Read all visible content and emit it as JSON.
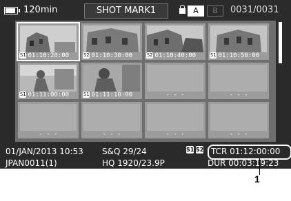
{
  "top_bar": {
    "battery_time": "120min",
    "screen_title": "SHOT MARK1",
    "slot_a": "A",
    "slot_b": "B",
    "clip_counter": "0031/0031"
  },
  "thumbnails": [
    {
      "mark": "S1",
      "timecode": "01:10:20:00",
      "image": "building-photo"
    },
    {
      "mark": "S2",
      "timecode": "01:10:30:00",
      "image": "building-photo"
    },
    {
      "mark": "S2",
      "timecode": "01:10:40:00",
      "image": "building-photo"
    },
    {
      "mark": "S1",
      "timecode": "01:10:50:00",
      "image": "building-photo"
    },
    {
      "mark": "S1",
      "timecode": "01:11:00:00",
      "image": "woman-photo"
    },
    {
      "mark": "S1",
      "timecode": "01:11:10:00",
      "image": "woman-photo"
    },
    {
      "empty": "- - -"
    },
    {
      "empty": "- - -"
    },
    {
      "empty": "- - -"
    },
    {
      "empty": "- - -"
    },
    {
      "empty": "- - -"
    },
    {
      "empty": "- - -"
    }
  ],
  "info": {
    "date_time": "01/JAN/2013 10:53",
    "sq": "S&Q 29/24",
    "mark1": "S1",
    "mark2": "S2",
    "tcr": "TCR 01:12:00:00",
    "clip_name": "JPAN0011(1)",
    "format": "HQ 1920/23.9P",
    "duration": "DUR 00:03:19:23"
  },
  "callout": "1",
  "colors": {
    "screen_bg": "#2a2a2a",
    "grid_bg": "#6e6e6e",
    "text": "#ffffff"
  }
}
